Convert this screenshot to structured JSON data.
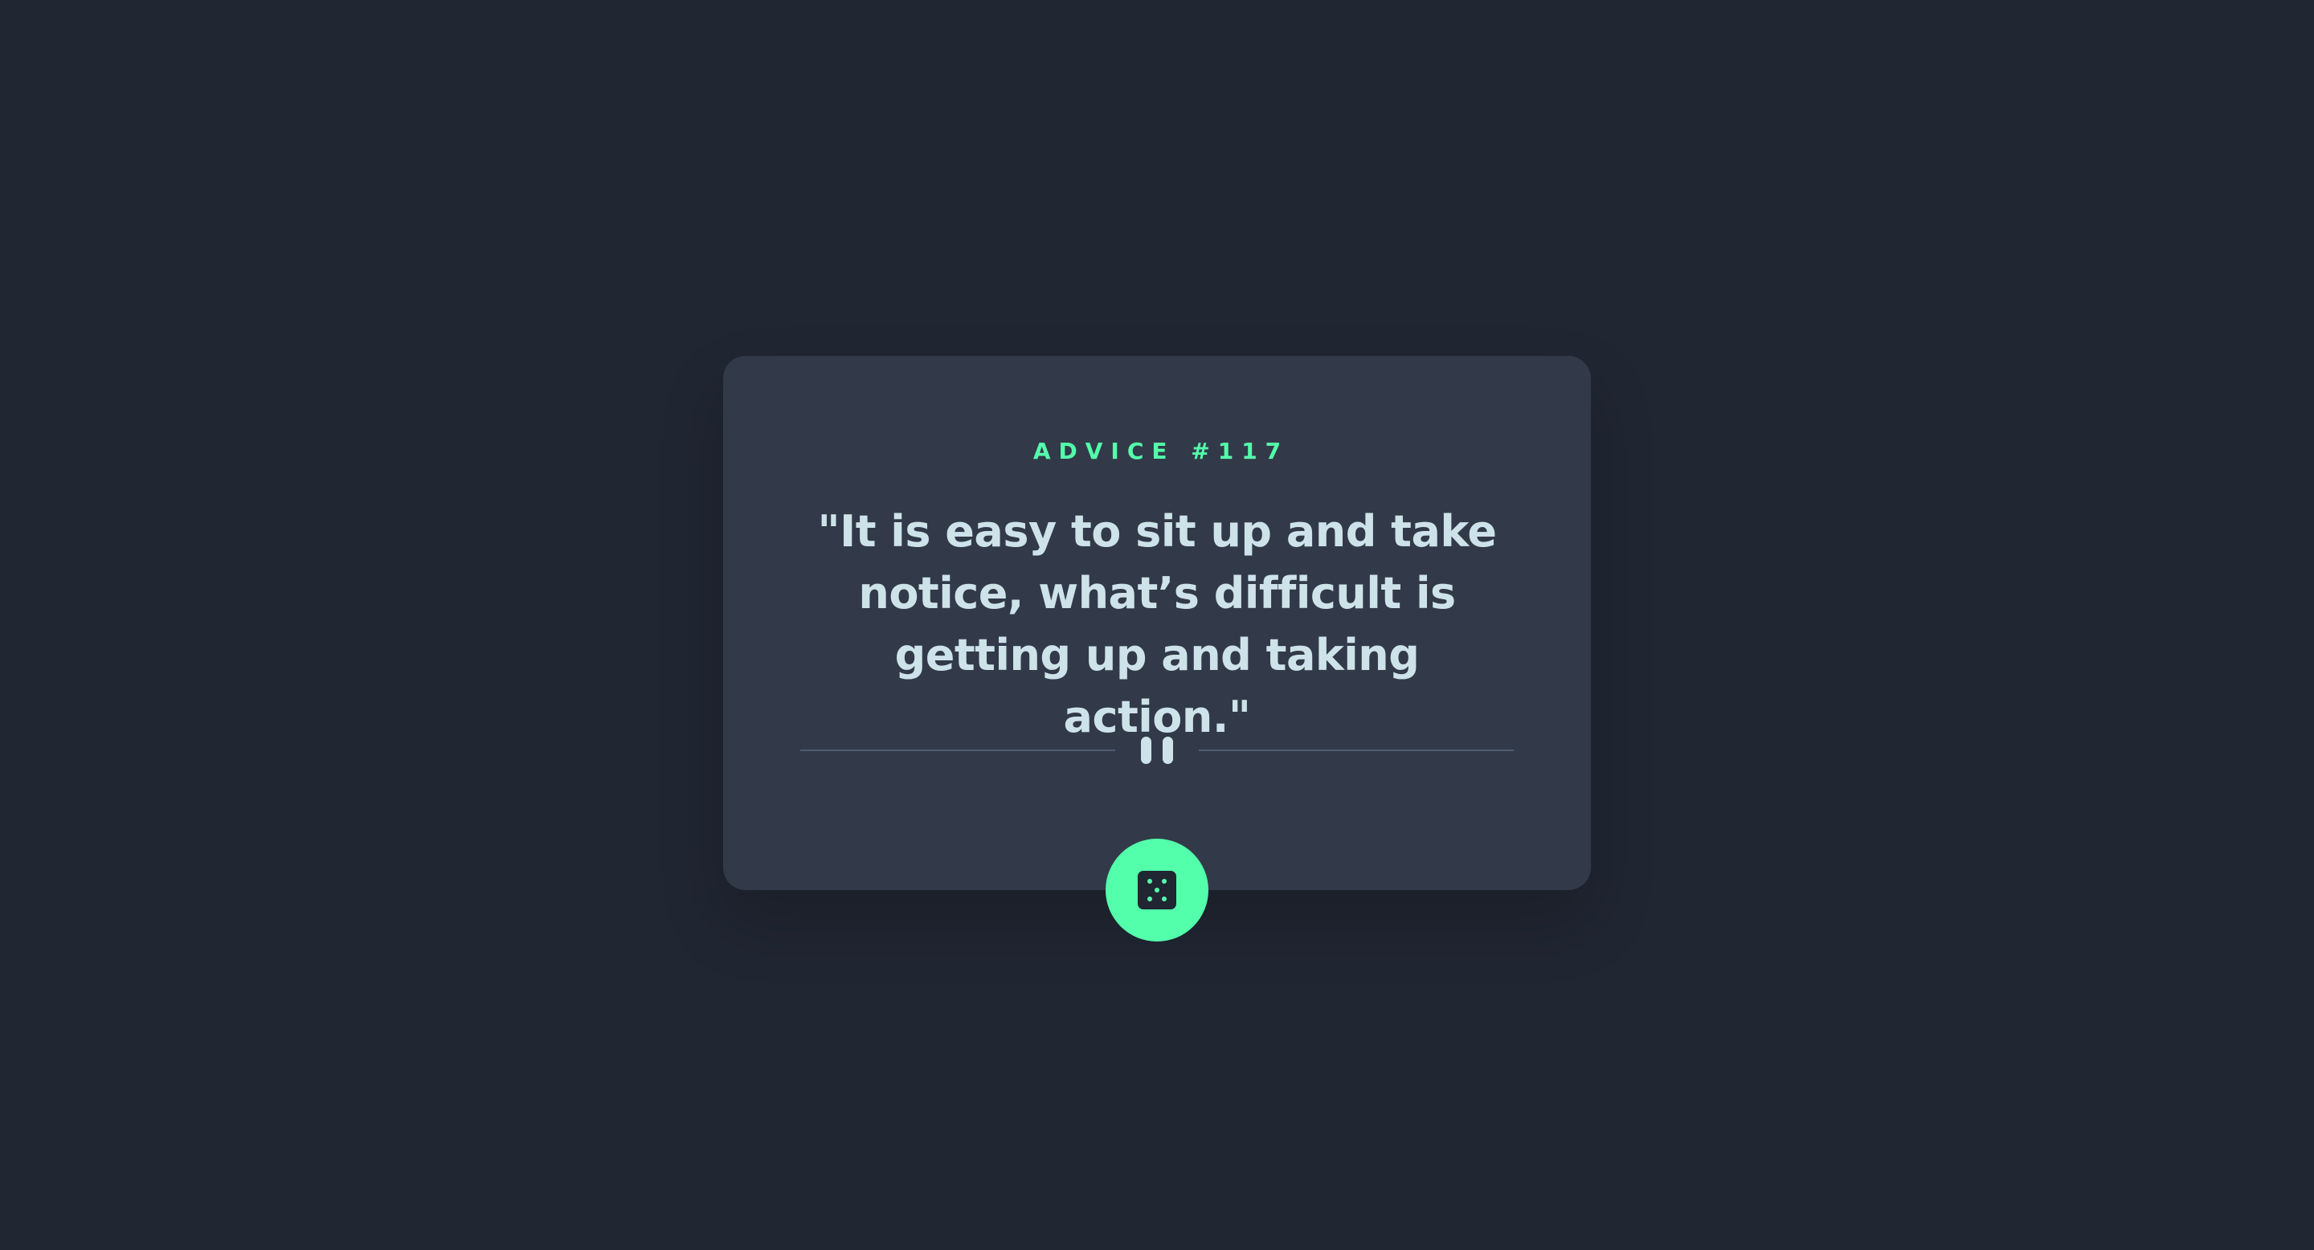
{
  "advice": {
    "label": "ADVICE #117",
    "quote": "\"It is easy to sit up and take notice, what’s difficult is getting up and taking action.\""
  },
  "divider": {
    "icon": "pause-icon"
  },
  "dice_button": {
    "icon": "dice-icon"
  },
  "colors": {
    "background": "#202632",
    "card": "#323a49",
    "accent": "#53ffaa",
    "text": "#cee3e9",
    "divider": "#4f5d74"
  }
}
